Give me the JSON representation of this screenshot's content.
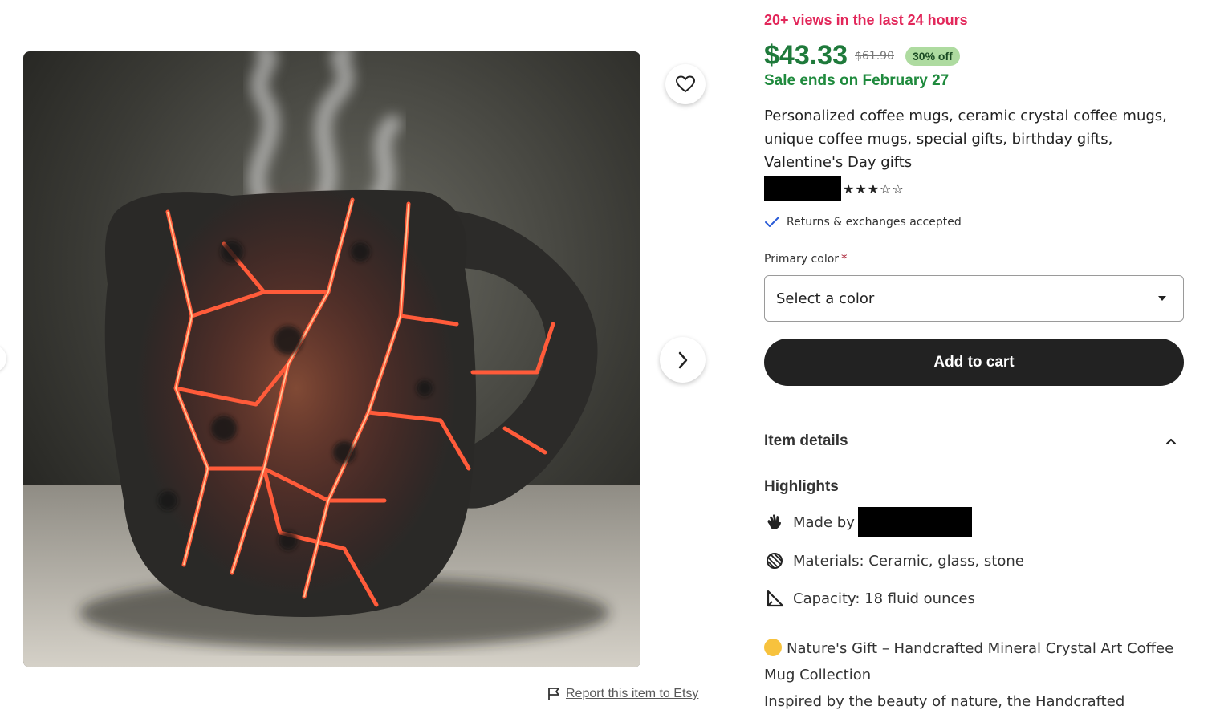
{
  "listing": {
    "views_text": "20+ views in the last 24 hours",
    "price": "$43.33",
    "original_price": "$61.90",
    "discount_badge": "30% off",
    "sale_ends": "Sale ends on February 27",
    "title": "Personalized coffee mugs, ceramic crystal coffee mugs, unique coffee mugs, special gifts, birthday gifts, Valentine's Day gifts",
    "rating_stars": "★★★☆☆",
    "rating_value": 3,
    "rating_max": 5,
    "returns_text": "Returns & exchanges accepted"
  },
  "variation": {
    "label": "Primary color",
    "required_marker": "*",
    "select_value": "Select a color"
  },
  "actions": {
    "add_to_cart": "Add to cart",
    "report_link": "Report this item to Etsy"
  },
  "details": {
    "section_title": "Item details",
    "highlights_title": "Highlights",
    "made_by_label": "Made by",
    "materials": "Materials: Ceramic, glass, stone",
    "capacity": "Capacity: 18 fluid ounces",
    "description_line1": "Nature's Gift – Handcrafted Mineral Crystal Art Coffee Mug Collection",
    "description_line2": "Inspired by the beauty of nature, the Handcrafted"
  },
  "icons": {
    "favorite": "heart-icon",
    "next": "chevron-right-icon",
    "check": "checkmark-icon",
    "caret": "caret-down-icon",
    "collapse": "chevron-up-icon",
    "made_by": "hand-wave-icon",
    "materials": "yarn-ball-icon",
    "capacity": "ruler-triangle-icon",
    "flag": "flag-icon",
    "emoji": "smiling-face-icon"
  },
  "colors": {
    "views": "#e2275a",
    "price": "#1f7a3b",
    "discount_bg": "#aedba0",
    "button_bg": "#222222"
  }
}
